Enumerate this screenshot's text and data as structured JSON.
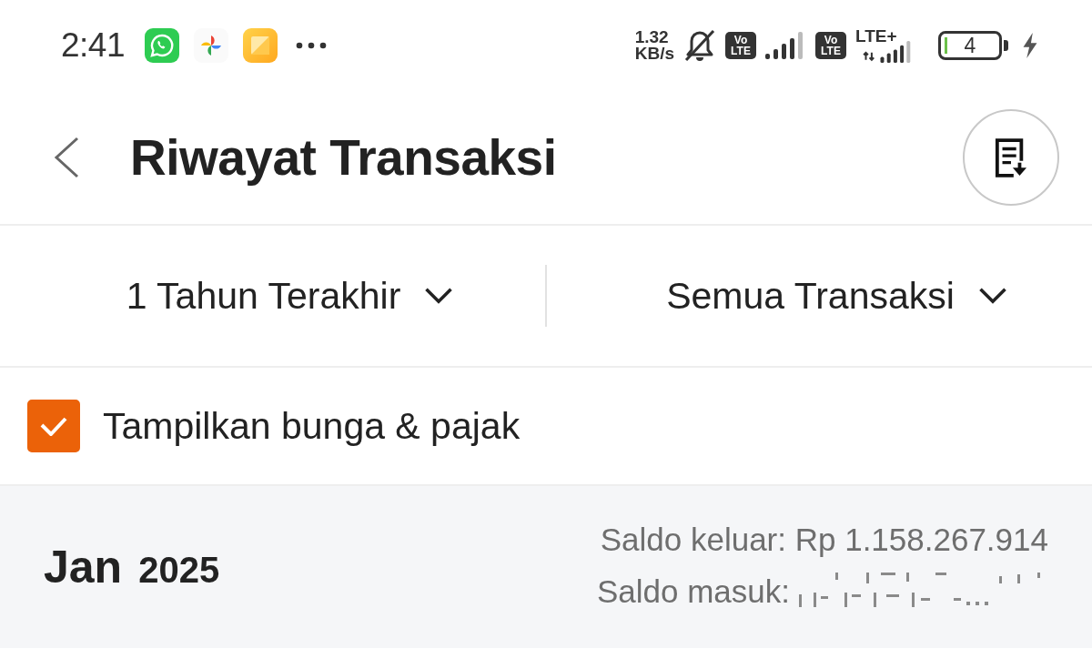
{
  "status_bar": {
    "time": "2:41",
    "speed_value": "1.32",
    "speed_unit": "KB/s",
    "sim_badges": [
      {
        "top": "Vo",
        "bottom": "LTE"
      },
      {
        "top": "Vo",
        "bottom": "LTE"
      }
    ],
    "network_type": "LTE+",
    "battery": "4",
    "charging": true
  },
  "header": {
    "title": "Riwayat Transaksi"
  },
  "filters": [
    {
      "label": "1 Tahun Terakhir"
    },
    {
      "label": "Semua Transaksi"
    }
  ],
  "checkbox": {
    "label": "Tampilkan bunga & pajak",
    "checked": true
  },
  "month": {
    "month": "Jan",
    "year": "2025",
    "lines": [
      {
        "label": "Saldo keluar: Rp 1.158.267.914",
        "redacted": false
      },
      {
        "label": "Saldo masuk:",
        "redacted": true
      }
    ]
  }
}
